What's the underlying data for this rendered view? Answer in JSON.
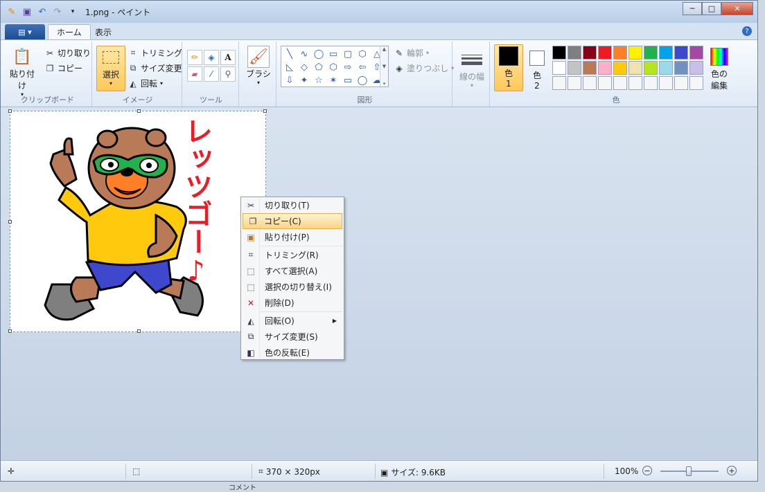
{
  "window": {
    "title": "1.png - ペイント",
    "app_icon": "paint-icon"
  },
  "qat": {
    "save_icon": "save-icon",
    "undo_icon": "undo-icon",
    "redo_icon": "redo-icon",
    "more_icon": "dropdown-icon"
  },
  "tabs": [
    {
      "label": "ホーム",
      "active": true
    },
    {
      "label": "表示",
      "active": false
    }
  ],
  "ribbon": {
    "clipboard": {
      "paste": "貼り付け",
      "cut": "切り取り",
      "copy": "コピー",
      "label": "クリップボード"
    },
    "image": {
      "select": "選択",
      "crop": "トリミング",
      "resize": "サイズ変更",
      "rotate": "回転",
      "label": "イメージ"
    },
    "tools": {
      "label": "ツール",
      "items": [
        "pencil-icon",
        "fill-icon",
        "text-icon",
        "eraser-icon",
        "picker-icon",
        "magnifier-icon"
      ]
    },
    "brush": {
      "label": "ブラシ"
    },
    "shapes": {
      "label": "図形",
      "outline": "輪郭",
      "fill": "塗りつぶし",
      "glyphs": [
        "╲",
        "∿",
        "◯",
        "▭",
        "▢",
        "⬡",
        "△",
        "◺",
        "◇",
        "⬠",
        "⬡",
        "⇨",
        "⇦",
        "⇧",
        "⇩",
        "✦",
        "☆",
        "✶",
        "▭",
        "◯",
        "☁"
      ]
    },
    "linewidth": {
      "label": "線の幅"
    },
    "colors": {
      "label": "色",
      "color1": "色\n1",
      "color1_a": "色",
      "color1_b": "1",
      "color2_a": "色",
      "color2_b": "2",
      "edit_a": "色の",
      "edit_b": "編集",
      "color1_value": "#000000",
      "color2_value": "#ffffff",
      "swatches": [
        "#000000",
        "#7f7f7f",
        "#880015",
        "#ed1c24",
        "#ff7f27",
        "#fff200",
        "#22b14c",
        "#00a2e8",
        "#3f48cc",
        "#a349a4",
        "#ffffff",
        "#c3c3c3",
        "#b97a57",
        "#ffaec9",
        "#ffc90e",
        "#efe4b0",
        "#b5e61d",
        "#99d9ea",
        "#7092be",
        "#c8bfe7",
        "#f4f6f8",
        "#f4f6f8",
        "#f4f6f8",
        "#f4f6f8",
        "#f4f6f8",
        "#f4f6f8",
        "#f4f6f8",
        "#f4f6f8",
        "#f4f6f8",
        "#f4f6f8"
      ]
    }
  },
  "canvas": {
    "lyrics": "レッツゴー♪"
  },
  "context_menu": {
    "items": [
      {
        "label": "切り取り(T)",
        "icon": "cut-icon"
      },
      {
        "label": "コピー(C)",
        "icon": "copy-icon",
        "highlighted": true
      },
      {
        "label": "貼り付け(P)",
        "icon": "paste-icon"
      },
      {
        "label": "トリミング(R)",
        "icon": "crop-icon"
      },
      {
        "label": "すべて選択(A)",
        "icon": "select-all-icon"
      },
      {
        "label": "選択の切り替え(I)",
        "icon": "invert-selection-icon"
      },
      {
        "label": "削除(D)",
        "icon": "delete-icon"
      },
      {
        "label": "回転(O)",
        "icon": "rotate-icon"
      },
      {
        "label": "サイズ変更(S)",
        "icon": "resize-icon"
      },
      {
        "label": "色の反転(E)",
        "icon": "invert-color-icon"
      }
    ]
  },
  "status": {
    "dimensions": "370 × 320px",
    "size": "サイズ: 9.6KB",
    "zoom": "100%"
  },
  "taskbar_behind": "コメント"
}
